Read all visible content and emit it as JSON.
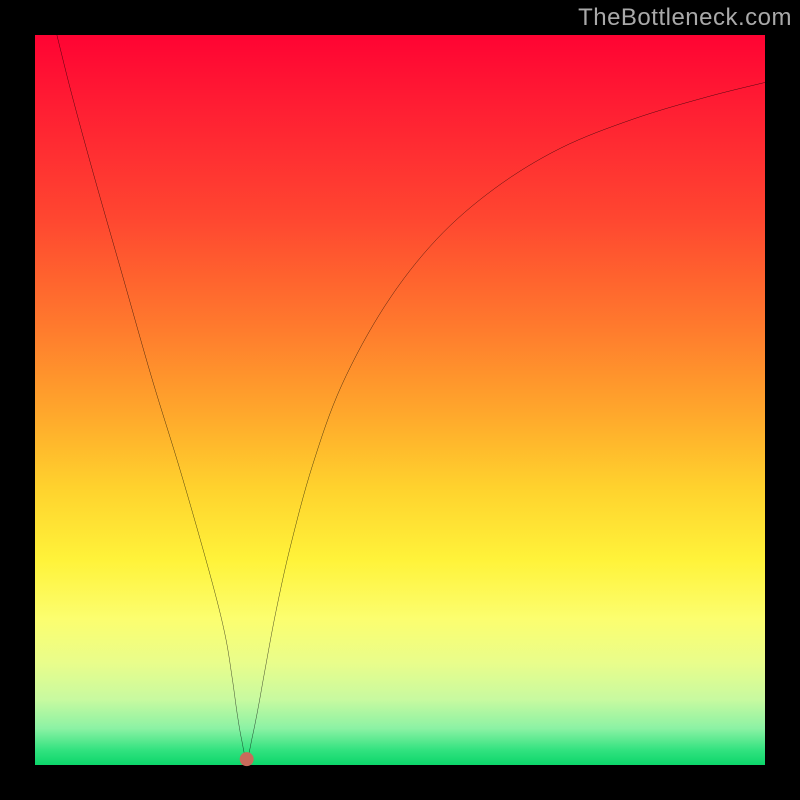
{
  "watermark": "TheBottleneck.com",
  "chart_data": {
    "type": "line",
    "title": "",
    "xlabel": "",
    "ylabel": "",
    "xlim": [
      0,
      100
    ],
    "ylim": [
      0,
      100
    ],
    "grid": false,
    "legend": false,
    "marker": {
      "x": 29,
      "y": 0.8,
      "color": "#c96a5b",
      "radius_px": 7
    },
    "series": [
      {
        "name": "bottleneck-curve",
        "color": "#000000",
        "x": [
          3,
          5,
          8,
          12,
          16,
          20,
          24,
          26,
          27,
          27.7,
          28.3,
          29,
          29.8,
          30.6,
          31.5,
          33,
          35,
          38,
          42,
          48,
          55,
          63,
          72,
          82,
          92,
          100
        ],
        "y": [
          100,
          92,
          81,
          67,
          53,
          40,
          26,
          18,
          12,
          7,
          3.5,
          0.8,
          4,
          8,
          13,
          21,
          30,
          41,
          52,
          63,
          72,
          79,
          84.5,
          88.5,
          91.5,
          93.5
        ]
      }
    ]
  }
}
